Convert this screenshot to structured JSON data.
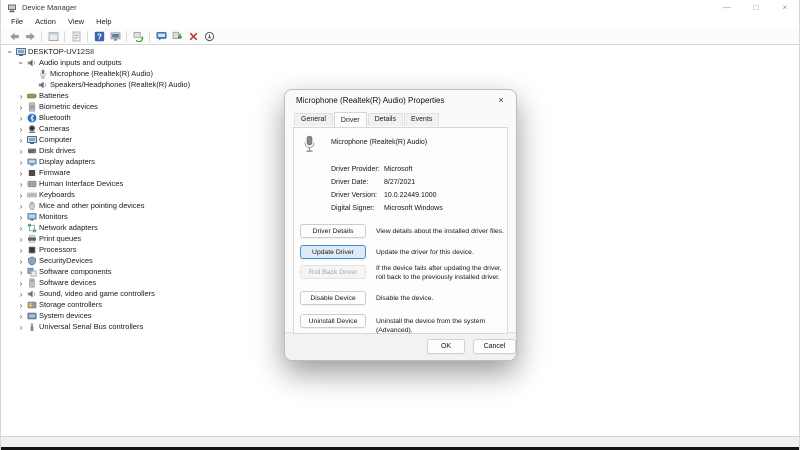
{
  "window": {
    "title": "Device Manager",
    "controls": {
      "minimize": "—",
      "maximize": "□",
      "close": "×"
    }
  },
  "menu": {
    "items": [
      {
        "label": "File"
      },
      {
        "label": "Action"
      },
      {
        "label": "View"
      },
      {
        "label": "Help"
      }
    ]
  },
  "toolbar": {
    "items": [
      "back-icon",
      "forward-icon",
      "sep",
      "console-window-icon",
      "sep",
      "export-list-icon",
      "sep",
      "help-icon",
      "properties-icon",
      "sep",
      "scan-hardware-icon",
      "sep",
      "troubleshoot-icon",
      "update-driver-icon",
      "uninstall-device-icon",
      "disable-device-icon"
    ]
  },
  "tree": {
    "items": [
      {
        "name": "tree-item-desktop-uv12sii",
        "label": "DESKTOP-UV12SII",
        "level": 0,
        "chevron": "expanded",
        "icon": "computer-icon"
      },
      {
        "name": "tree-item-audio-inputs-and-outputs",
        "label": "Audio inputs and outputs",
        "level": 1,
        "chevron": "expanded",
        "icon": "speaker-icon"
      },
      {
        "name": "tree-item-microphone",
        "label": "Microphone (Realtek(R) Audio)",
        "level": 2,
        "chevron": "none",
        "icon": "microphone-icon"
      },
      {
        "name": "tree-item-speakers-headphones",
        "label": "Speakers/Headphones (Realtek(R) Audio)",
        "level": 2,
        "chevron": "none",
        "icon": "speaker-icon"
      },
      {
        "name": "tree-item-batteries",
        "label": "Batteries",
        "level": 1,
        "chevron": "collapsed",
        "icon": "battery-icon"
      },
      {
        "name": "tree-item-biometric-devices",
        "label": "Biometric devices",
        "level": 1,
        "chevron": "collapsed",
        "icon": "fingerprint-icon"
      },
      {
        "name": "tree-item-bluetooth",
        "label": "Bluetooth",
        "level": 1,
        "chevron": "collapsed",
        "icon": "bluetooth-icon"
      },
      {
        "name": "tree-item-cameras",
        "label": "Cameras",
        "level": 1,
        "chevron": "collapsed",
        "icon": "camera-icon"
      },
      {
        "name": "tree-item-computer",
        "label": "Computer",
        "level": 1,
        "chevron": "collapsed",
        "icon": "computer-icon"
      },
      {
        "name": "tree-item-disk-drives",
        "label": "Disk drives",
        "level": 1,
        "chevron": "collapsed",
        "icon": "disk-icon"
      },
      {
        "name": "tree-item-display-adapters",
        "label": "Display adapters",
        "level": 1,
        "chevron": "collapsed",
        "icon": "display-adapter-icon"
      },
      {
        "name": "tree-item-firmware",
        "label": "Firmware",
        "level": 1,
        "chevron": "collapsed",
        "icon": "firmware-icon"
      },
      {
        "name": "tree-item-human-interface-devices",
        "label": "Human Interface Devices",
        "level": 1,
        "chevron": "collapsed",
        "icon": "hid-icon"
      },
      {
        "name": "tree-item-keyboards",
        "label": "Keyboards",
        "level": 1,
        "chevron": "collapsed",
        "icon": "keyboard-icon"
      },
      {
        "name": "tree-item-mice",
        "label": "Mice and other pointing devices",
        "level": 1,
        "chevron": "collapsed",
        "icon": "mouse-icon"
      },
      {
        "name": "tree-item-monitors",
        "label": "Monitors",
        "level": 1,
        "chevron": "collapsed",
        "icon": "monitor-icon"
      },
      {
        "name": "tree-item-network-adapters",
        "label": "Network adapters",
        "level": 1,
        "chevron": "collapsed",
        "icon": "network-icon"
      },
      {
        "name": "tree-item-print-queues",
        "label": "Print queues",
        "level": 1,
        "chevron": "collapsed",
        "icon": "printer-icon"
      },
      {
        "name": "tree-item-processors",
        "label": "Processors",
        "level": 1,
        "chevron": "collapsed",
        "icon": "processor-icon"
      },
      {
        "name": "tree-item-securitydevices",
        "label": "SecurityDevices",
        "level": 1,
        "chevron": "collapsed",
        "icon": "security-icon"
      },
      {
        "name": "tree-item-software-components",
        "label": "Software components",
        "level": 1,
        "chevron": "collapsed",
        "icon": "software-component-icon"
      },
      {
        "name": "tree-item-software-devices",
        "label": "Software devices",
        "level": 1,
        "chevron": "collapsed",
        "icon": "software-device-icon"
      },
      {
        "name": "tree-item-sound-video-game-controllers",
        "label": "Sound, video and game controllers",
        "level": 1,
        "chevron": "collapsed",
        "icon": "speaker-icon"
      },
      {
        "name": "tree-item-storage-controllers",
        "label": "Storage controllers",
        "level": 1,
        "chevron": "collapsed",
        "icon": "storage-icon"
      },
      {
        "name": "tree-item-system-devices",
        "label": "System devices",
        "level": 1,
        "chevron": "collapsed",
        "icon": "system-icon"
      },
      {
        "name": "tree-item-usb-controllers",
        "label": "Universal Serial Bus controllers",
        "level": 1,
        "chevron": "collapsed",
        "icon": "usb-icon"
      }
    ]
  },
  "dialog": {
    "title": "Microphone (Realtek(R) Audio) Properties",
    "close_glyph": "×",
    "tabs": [
      {
        "label": "General",
        "active": false
      },
      {
        "label": "Driver",
        "active": true
      },
      {
        "label": "Details",
        "active": false
      },
      {
        "label": "Events",
        "active": false
      }
    ],
    "device_name": "Microphone (Realtek(R) Audio)",
    "fields": [
      {
        "label": "Driver Provider:",
        "value": "Microsoft"
      },
      {
        "label": "Driver Date:",
        "value": "8/27/2021"
      },
      {
        "label": "Driver Version:",
        "value": "10.0.22449.1000"
      },
      {
        "label": "Digital Signer:",
        "value": "Microsoft Windows"
      }
    ],
    "actions": [
      {
        "button": "Driver Details",
        "desc": "View details about the installed driver files.",
        "state": "normal"
      },
      {
        "button": "Update Driver",
        "desc": "Update the driver for this device.",
        "state": "focused"
      },
      {
        "button": "Roll Back Driver",
        "desc": "If the device fails after updating the driver, roll back to the previously installed driver.",
        "state": "disabled"
      },
      {
        "button": "Disable Device",
        "desc": "Disable the device.",
        "state": "normal"
      },
      {
        "button": "Uninstall Device",
        "desc": "Uninstall the device from the system (Advanced).",
        "state": "normal"
      }
    ],
    "footer": {
      "ok": "OK",
      "cancel": "Cancel"
    }
  },
  "colors": {
    "accent": "#4a8fc7",
    "focused_button_bg": "#dcebf7",
    "bluetooth_blue": "#2a6bc5",
    "uninstall_red": "#c23a2e",
    "scan_green": "#3f9e3f"
  }
}
